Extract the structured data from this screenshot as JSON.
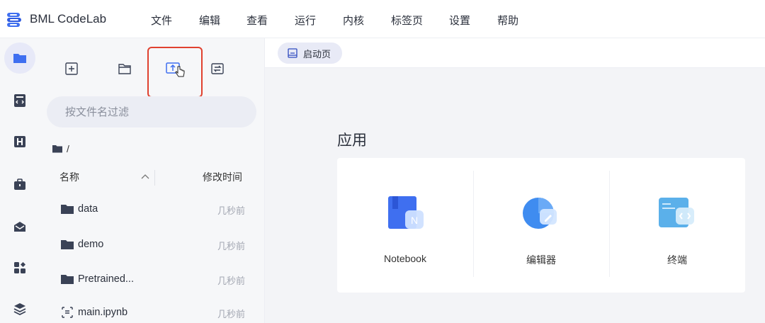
{
  "app": {
    "title": "BML CodeLab"
  },
  "menu": [
    "文件",
    "编辑",
    "查看",
    "运行",
    "内核",
    "标签页",
    "设置",
    "帮助"
  ],
  "activity_bar": [
    {
      "icon": "folder-icon",
      "active": true
    },
    {
      "icon": "code-file-icon",
      "active": false
    },
    {
      "icon": "h-logo-icon",
      "active": false
    },
    {
      "icon": "briefcase-icon",
      "active": false
    },
    {
      "icon": "envelope-icon",
      "active": false
    },
    {
      "icon": "widgets-icon",
      "active": false
    },
    {
      "icon": "layers-icon",
      "active": false
    }
  ],
  "file_toolbar": [
    {
      "icon": "new-launcher-icon"
    },
    {
      "icon": "new-folder-icon"
    },
    {
      "icon": "upload-icon",
      "highlighted": true
    },
    {
      "icon": "refresh-icon"
    }
  ],
  "filter": {
    "placeholder": "按文件名过滤",
    "value": ""
  },
  "breadcrumb": {
    "path": "/"
  },
  "columns": {
    "name": "名称",
    "modified": "修改时间"
  },
  "files": [
    {
      "name": "data",
      "type": "folder",
      "modified": "几秒前"
    },
    {
      "name": "demo",
      "type": "folder",
      "modified": "几秒前"
    },
    {
      "name": "Pretrained...",
      "type": "folder",
      "modified": "几秒前"
    },
    {
      "name": "main.ipynb",
      "type": "notebook",
      "modified": "几秒前"
    }
  ],
  "tabs": [
    {
      "label": "启动页",
      "active": true
    }
  ],
  "launcher": {
    "section_title": "应用",
    "cards": [
      {
        "label": "Notebook",
        "icon": "notebook-icon"
      },
      {
        "label": "编辑器",
        "icon": "editor-icon"
      },
      {
        "label": "终端",
        "icon": "terminal-icon"
      }
    ]
  },
  "colors": {
    "accent": "#3f6ff0",
    "highlight_border": "#e0412f",
    "active_bg": "#e7e9f8"
  }
}
